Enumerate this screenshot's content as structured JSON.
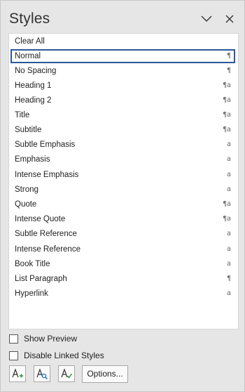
{
  "pane": {
    "title": "Styles"
  },
  "header_icons": {
    "collapse": "chevron-down-icon",
    "close": "close-icon"
  },
  "styles": [
    {
      "label": "Clear All",
      "mark": ""
    },
    {
      "label": "Normal",
      "mark": "¶"
    },
    {
      "label": "No Spacing",
      "mark": "¶"
    },
    {
      "label": "Heading 1",
      "mark": "¶a"
    },
    {
      "label": "Heading 2",
      "mark": "¶a"
    },
    {
      "label": "Title",
      "mark": "¶a"
    },
    {
      "label": "Subtitle",
      "mark": "¶a"
    },
    {
      "label": "Subtle Emphasis",
      "mark": "a"
    },
    {
      "label": "Emphasis",
      "mark": "a"
    },
    {
      "label": "Intense Emphasis",
      "mark": "a"
    },
    {
      "label": "Strong",
      "mark": "a"
    },
    {
      "label": "Quote",
      "mark": "¶a"
    },
    {
      "label": "Intense Quote",
      "mark": "¶a"
    },
    {
      "label": "Subtle Reference",
      "mark": "a"
    },
    {
      "label": "Intense Reference",
      "mark": "a"
    },
    {
      "label": "Book Title",
      "mark": "a"
    },
    {
      "label": "List Paragraph",
      "mark": "¶"
    },
    {
      "label": "Hyperlink",
      "mark": "a"
    }
  ],
  "selected_style": "Normal",
  "options": {
    "show_preview": {
      "label": "Show Preview",
      "checked": false
    },
    "disable_linked": {
      "label": "Disable Linked Styles",
      "checked": false
    }
  },
  "toolbar": {
    "new_style_icon": "new-style-icon",
    "style_inspector_icon": "style-inspector-icon",
    "manage_styles_icon": "manage-styles-icon",
    "options_label": "Options..."
  },
  "colors": {
    "selection_border": "#2b579a",
    "accent_green": "#2e8b3e",
    "accent_blue": "#1e6fc7"
  }
}
